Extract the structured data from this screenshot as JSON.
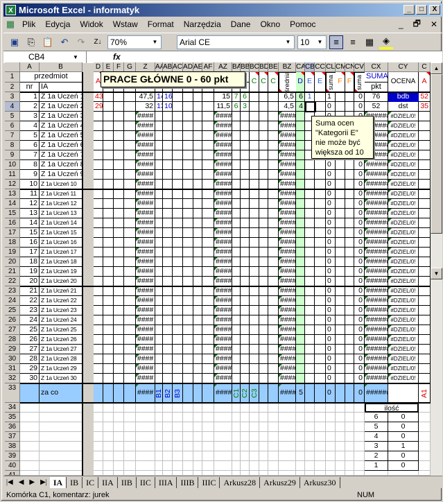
{
  "window": {
    "title": "Microsoft Excel - informatyk",
    "minimize": "_",
    "maximize": "□",
    "close": "X"
  },
  "menu": [
    "Plik",
    "Edycja",
    "Widok",
    "Wstaw",
    "Format",
    "Narzędzia",
    "Dane",
    "Okno",
    "Pomoc"
  ],
  "toolbar": {
    "zoom": "70%",
    "font": "Arial CE",
    "font_size": "10"
  },
  "formula_bar": {
    "name_box": "CB4",
    "fx": "fx",
    "value": ""
  },
  "columns": [
    "A",
    "B",
    "C",
    "D",
    "E",
    "F",
    "G",
    "Z",
    "AA",
    "AB",
    "AC",
    "AD",
    "AE",
    "AF",
    "AZ",
    "BA",
    "BB",
    "BC",
    "BD",
    "BE",
    "BZ",
    "CA",
    "CB",
    "CC",
    "CL",
    "CM",
    "CN",
    "CV",
    "CX",
    "CY",
    "C"
  ],
  "header": {
    "przedmiot": "przedmiot",
    "nr": "nr",
    "class": "IA",
    "C": "A",
    "D": "A",
    "BC": "C",
    "BD": "C",
    "BE": "C",
    "BZ": "średnia",
    "CA": "D",
    "CB": "E",
    "CC": "E",
    "CL": "suma",
    "CM": "F",
    "CN": "F",
    "CV": "suma",
    "suma": "SUMA",
    "pkt": "pkt",
    "ocena": "OCENA"
  },
  "rows": [
    {
      "n": "3",
      "cells": {
        "A": "1",
        "B": "Z 1a Uczeń 1",
        "C": "52",
        "D": "43",
        "Z": "47,5",
        "AA": "14",
        "AB": "16",
        "AZ": "15",
        "BA": "7",
        "BB": "6",
        "BZ": "6,5",
        "CA": "6",
        "CB": "1",
        "CL": "1",
        "CV": "0",
        "CX": "76",
        "CY": "bdb"
      }
    },
    {
      "n": "4",
      "cells": {
        "A": "2",
        "B": "Z 1a Uczeń 2",
        "C": "35",
        "D": "29",
        "Z": "32",
        "AA": "13",
        "AB": "10",
        "AZ": "11,5",
        "BA": "6",
        "BB": "3",
        "BZ": "4,5",
        "CA": "4",
        "CL": "0",
        "CV": "0",
        "CX": "52",
        "CY": "dst"
      }
    },
    {
      "n": "5",
      "cells": {
        "A": "3",
        "B": "Z 1a Uczeń 3",
        "Z": "####",
        "AZ": "####",
        "BZ": "####",
        "CL": "0",
        "CV": "0",
        "CX": "######",
        "CY": "#DZIEL/0!"
      }
    },
    {
      "n": "6",
      "cells": {
        "A": "4",
        "B": "Z 1a Uczeń 4",
        "Z": "####",
        "AZ": "####",
        "BZ": "####",
        "CL": "0",
        "CV": "0",
        "CX": "######",
        "CY": "#DZIEL/0!"
      }
    },
    {
      "n": "7",
      "cells": {
        "A": "5",
        "B": "Z 1a Uczeń 5",
        "Z": "####",
        "AZ": "####",
        "BZ": "####",
        "CL": "0",
        "CV": "0",
        "CX": "######",
        "CY": "#DZIEL/0!"
      }
    },
    {
      "n": "8",
      "cells": {
        "A": "6",
        "B": "Z 1a Uczeń 6",
        "Z": "####",
        "AZ": "####",
        "BZ": "####",
        "CL": "0",
        "CV": "0",
        "CX": "######",
        "CY": "#DZIEL/0!"
      }
    },
    {
      "n": "9",
      "cells": {
        "A": "7",
        "B": "Z 1a Uczeń 7",
        "Z": "####",
        "AZ": "####",
        "BZ": "####",
        "CL": "0",
        "CV": "0",
        "CX": "######",
        "CY": "#DZIEL/0!"
      }
    },
    {
      "n": "10",
      "cells": {
        "A": "8",
        "B": "Z 1a Uczeń 8",
        "Z": "####",
        "AZ": "####",
        "BZ": "####",
        "CL": "0",
        "CV": "0",
        "CX": "######",
        "CY": "#DZIEL/0!"
      }
    },
    {
      "n": "11",
      "cells": {
        "A": "9",
        "B": "Z 1a Uczeń 9",
        "Z": "####",
        "AZ": "####",
        "BZ": "####",
        "CL": "0",
        "CV": "0",
        "CX": "######",
        "CY": "#DZIEL/0!"
      }
    },
    {
      "n": "12",
      "cells": {
        "A": "10",
        "B": "Z 1a Uczeń 10",
        "Z": "####",
        "AZ": "####",
        "BZ": "####",
        "CL": "0",
        "CV": "0",
        "CX": "######",
        "CY": "#DZIEL/0!"
      }
    },
    {
      "n": "13",
      "cells": {
        "A": "11",
        "B": "Z 1a Uczeń 11",
        "Z": "####",
        "AZ": "####",
        "BZ": "####",
        "CL": "0",
        "CV": "0",
        "CX": "######",
        "CY": "#DZIEL/0!"
      }
    },
    {
      "n": "14",
      "cells": {
        "A": "12",
        "B": "Z 1a Uczeń 12",
        "Z": "####",
        "AZ": "####",
        "BZ": "####",
        "CL": "0",
        "CV": "0",
        "CX": "######",
        "CY": "#DZIEL/0!"
      }
    },
    {
      "n": "15",
      "cells": {
        "A": "13",
        "B": "Z 1a Uczeń 13",
        "Z": "####",
        "AZ": "####",
        "BZ": "####",
        "CL": "0",
        "CV": "0",
        "CX": "######",
        "CY": "#DZIEL/0!"
      }
    },
    {
      "n": "16",
      "cells": {
        "A": "14",
        "B": "Z 1a Uczeń 14",
        "Z": "####",
        "AZ": "####",
        "BZ": "####",
        "CL": "0",
        "CV": "0",
        "CX": "######",
        "CY": "#DZIEL/0!"
      }
    },
    {
      "n": "17",
      "cells": {
        "A": "15",
        "B": "Z 1a Uczeń 15",
        "Z": "####",
        "AZ": "####",
        "BZ": "####",
        "CL": "0",
        "CV": "0",
        "CX": "######",
        "CY": "#DZIEL/0!"
      }
    },
    {
      "n": "18",
      "cells": {
        "A": "16",
        "B": "Z 1a Uczeń 16",
        "Z": "####",
        "AZ": "####",
        "BZ": "####",
        "CL": "0",
        "CV": "0",
        "CX": "######",
        "CY": "#DZIEL/0!"
      }
    },
    {
      "n": "19",
      "cells": {
        "A": "17",
        "B": "Z 1a Uczeń 17",
        "Z": "####",
        "AZ": "####",
        "BZ": "####",
        "CL": "0",
        "CV": "0",
        "CX": "######",
        "CY": "#DZIEL/0!"
      }
    },
    {
      "n": "20",
      "cells": {
        "A": "18",
        "B": "Z 1a Uczeń 18",
        "Z": "####",
        "AZ": "####",
        "BZ": "####",
        "CL": "0",
        "CV": "0",
        "CX": "######",
        "CY": "#DZIEL/0!"
      }
    },
    {
      "n": "21",
      "cells": {
        "A": "19",
        "B": "Z 1a Uczeń 19",
        "Z": "####",
        "AZ": "####",
        "BZ": "####",
        "CL": "0",
        "CV": "0",
        "CX": "######",
        "CY": "#DZIEL/0!"
      }
    },
    {
      "n": "22",
      "cells": {
        "A": "20",
        "B": "Z 1a Uczeń 20",
        "Z": "####",
        "AZ": "####",
        "BZ": "####",
        "CL": "0",
        "CV": "0",
        "CX": "######",
        "CY": "#DZIEL/0!"
      }
    },
    {
      "n": "23",
      "cells": {
        "A": "21",
        "B": "Z 1a Uczeń 21",
        "Z": "####",
        "AZ": "####",
        "BZ": "####",
        "CL": "0",
        "CV": "0",
        "CX": "######",
        "CY": "#DZIEL/0!"
      }
    },
    {
      "n": "24",
      "cells": {
        "A": "22",
        "B": "Z 1a Uczeń 22",
        "Z": "####",
        "AZ": "####",
        "BZ": "####",
        "CL": "0",
        "CV": "0",
        "CX": "######",
        "CY": "#DZIEL/0!"
      }
    },
    {
      "n": "25",
      "cells": {
        "A": "23",
        "B": "Z 1a Uczeń 23",
        "Z": "####",
        "AZ": "####",
        "BZ": "####",
        "CL": "0",
        "CV": "0",
        "CX": "######",
        "CY": "#DZIEL/0!"
      }
    },
    {
      "n": "26",
      "cells": {
        "A": "24",
        "B": "Z 1a Uczeń 24",
        "Z": "####",
        "AZ": "####",
        "BZ": "####",
        "CL": "0",
        "CV": "0",
        "CX": "######",
        "CY": "#DZIEL/0!"
      }
    },
    {
      "n": "27",
      "cells": {
        "A": "25",
        "B": "Z 1a Uczeń 25",
        "Z": "####",
        "AZ": "####",
        "BZ": "####",
        "CL": "0",
        "CV": "0",
        "CX": "######",
        "CY": "#DZIEL/0!"
      }
    },
    {
      "n": "28",
      "cells": {
        "A": "26",
        "B": "Z 1a Uczeń 26",
        "Z": "####",
        "AZ": "####",
        "BZ": "####",
        "CL": "0",
        "CV": "0",
        "CX": "######",
        "CY": "#DZIEL/0!"
      }
    },
    {
      "n": "29",
      "cells": {
        "A": "27",
        "B": "Z 1a Uczeń 27",
        "Z": "####",
        "AZ": "####",
        "BZ": "####",
        "CL": "0",
        "CV": "0",
        "CX": "######",
        "CY": "#DZIEL/0!"
      }
    },
    {
      "n": "30",
      "cells": {
        "A": "28",
        "B": "Z 1a Uczeń 28",
        "Z": "####",
        "AZ": "####",
        "BZ": "####",
        "CL": "0",
        "CV": "0",
        "CX": "######",
        "CY": "#DZIEL/0!"
      }
    },
    {
      "n": "31",
      "cells": {
        "A": "29",
        "B": "Z 1a Uczeń 29",
        "Z": "####",
        "AZ": "####",
        "BZ": "####",
        "CL": "0",
        "CV": "0",
        "CX": "######",
        "CY": "#DZIEL/0!"
      }
    },
    {
      "n": "32",
      "cells": {
        "A": "30",
        "B": "Z 1a Uczeń 30",
        "Z": "####",
        "AZ": "####",
        "BZ": "####",
        "CL": "0",
        "CV": "0",
        "CX": "######",
        "CY": "#DZIEL/0!"
      }
    },
    {
      "n": "33",
      "cells": {
        "B": "za co",
        "C": "A1",
        "Z": "####",
        "AA": "B1",
        "AB": "B2",
        "AC": "B3",
        "AZ": "####",
        "BA": "C1",
        "BB": "C2",
        "BC": "C3",
        "BZ": "####",
        "CA": "5",
        "CL": "0",
        "CV": "0",
        "CX": "######"
      }
    },
    {
      "n": "34",
      "cells": {
        "CX": "ilość"
      }
    },
    {
      "n": "35",
      "cells": {
        "CX": "6",
        "CY": "0"
      }
    },
    {
      "n": "36",
      "cells": {
        "CX": "5",
        "CY": "0"
      }
    },
    {
      "n": "37",
      "cells": {
        "CX": "4",
        "CY": "0"
      }
    },
    {
      "n": "38",
      "cells": {
        "CX": "3",
        "CY": "1"
      }
    },
    {
      "n": "39",
      "cells": {
        "CX": "2",
        "CY": "0"
      }
    },
    {
      "n": "40",
      "cells": {
        "CX": "1",
        "CY": "0"
      }
    },
    {
      "n": "41",
      "cells": {}
    }
  ],
  "comments": {
    "main": "PRACE GŁÓWNE 0 - 60 pkt",
    "category_e": "Suma ocen \"Kategorii E\" nie może być większa od 10"
  },
  "sheet_tabs": [
    "IA",
    "IB",
    "IC",
    "IIA",
    "IIB",
    "IIC",
    "IIIA",
    "IIIB",
    "IIIC",
    "Arkusz28",
    "Arkusz29",
    "Arkusz30"
  ],
  "active_tab": "IA",
  "status": {
    "text": "Komórka C1, komentarz: jurek",
    "num": "NUM"
  },
  "colors": {
    "grade_a": "#e00000",
    "grade_b": "#0000cc",
    "grade_c": "#008000",
    "category_d_bg": "#ccffcc",
    "za_co_row_bg": "#99ccff",
    "bdb_bg": "#0000cc",
    "comment_bg": "#ffffe1",
    "title_bar": "#0a246a"
  }
}
